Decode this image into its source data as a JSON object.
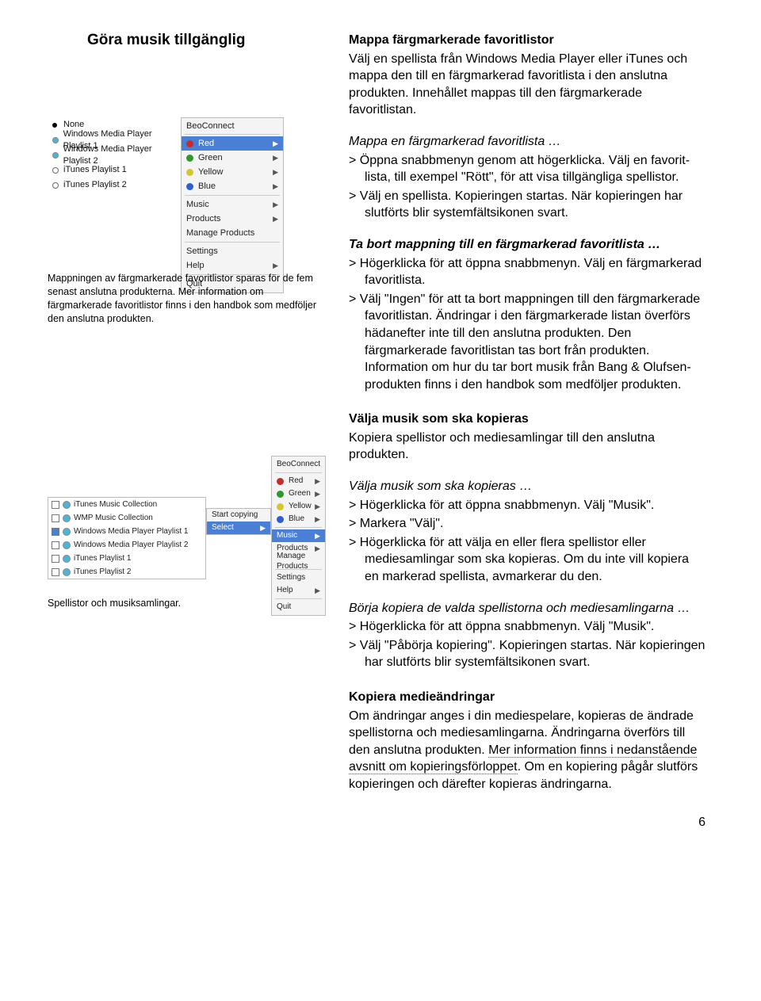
{
  "title": "Göra musik tillgänglig",
  "shot1": {
    "left_items": [
      {
        "mark": "bullet",
        "label": "None"
      },
      {
        "mark": "dot",
        "label": "Windows Media Player Playlist 1"
      },
      {
        "mark": "dot",
        "label": "Windows Media Player Playlist 2"
      },
      {
        "mark": "odot",
        "label": "iTunes Playlist 1"
      },
      {
        "mark": "odot",
        "label": "iTunes Playlist 2"
      }
    ],
    "ctx_header": "BeoConnect",
    "ctx_colors": [
      {
        "cls": "red",
        "label": "Red",
        "sel": true
      },
      {
        "cls": "green",
        "label": "Green"
      },
      {
        "cls": "yellow",
        "label": "Yellow"
      },
      {
        "cls": "blue",
        "label": "Blue"
      }
    ],
    "ctx_group2": [
      "Music",
      "Products",
      "Manage Products"
    ],
    "ctx_group3": [
      "Settings",
      "Help"
    ],
    "ctx_group4": [
      "Quit"
    ]
  },
  "caption1": "Mappningen av färgmarkerade favoritlistor sparas för de fem senast anslutna produkterna. Mer information om färgmarkerade favoritlistor finns i den handbok som medföljer den anslutna produkten.",
  "shot2": {
    "items": [
      {
        "chk": false,
        "label": "iTunes Music Collection"
      },
      {
        "chk": false,
        "label": "WMP Music Collection"
      },
      {
        "chk": true,
        "label": "Windows Media Player Playlist 1"
      },
      {
        "chk": false,
        "label": "Windows Media Player Playlist 2"
      },
      {
        "chk": false,
        "label": "iTunes Playlist 1"
      },
      {
        "chk": false,
        "label": "iTunes Playlist 2"
      }
    ],
    "sub_start": "Start copying",
    "sub_select": "Select",
    "ctx_header": "BeoConnect",
    "ctx_colors": [
      {
        "cls": "red",
        "label": "Red"
      },
      {
        "cls": "green",
        "label": "Green"
      },
      {
        "cls": "yellow",
        "label": "Yellow"
      },
      {
        "cls": "blue",
        "label": "Blue"
      }
    ],
    "music": "Music",
    "group2": [
      "Products",
      "Manage Products"
    ],
    "group3": [
      "Settings",
      "Help"
    ],
    "group4": [
      "Quit"
    ]
  },
  "caption2": "Spellistor och musiksamlingar.",
  "r": {
    "s1_h": "Mappa färgmarkerade favoritlistor",
    "s1_p": "Välj en spellista från Windows Media Player eller iTunes och mappa den till en färgmarkerad favoritlista i den anslutna produkten. Innehållet mappas till den färgmarkerade favoritlistan.",
    "s2_h": "Mappa en färgmarkerad favoritlista …",
    "s2_1a": ">  Öppna snabbmenyn genom att högerklicka. Välj en favorit-",
    "s2_1b": "lista, till exempel \"Rött\", för att visa tillgängliga spellistor.",
    "s2_2": ">  Välj en spellista. Kopieringen startas. När kopieringen har slutförts blir systemfältsikonen svart.",
    "s3_h": "Ta bort mappning till en färgmarkerad favoritlista …",
    "s3_1": ">  Högerklicka för att öppna snabbmenyn. Välj en färgmarkerad favoritlista.",
    "s3_2": ">  Välj \"Ingen\" för att ta bort mappningen till den färgmarkerade favoritlistan. Ändringar i den färgmarkerade listan överförs hädanefter inte till den anslutna produkten. Den färgmarkerade favoritlistan tas bort från produkten. Information om hur du tar bort musik från Bang & Olufsen-produkten finns i den handbok som medföljer produkten.",
    "s4_h": "Välja musik som ska kopieras",
    "s4_p": "Kopiera spellistor och mediesamlingar till den anslutna produkten.",
    "s5_h": "Välja musik som ska kopieras …",
    "s5_1": ">  Högerklicka för att öppna snabbmenyn. Välj \"Musik\".",
    "s5_2": ">  Markera \"Välj\".",
    "s5_3": ">  Högerklicka för att välja en eller flera spellistor eller mediesamlingar som ska kopieras. Om du inte vill kopiera en markerad spellista, avmarkerar du den.",
    "s6_h": "Börja kopiera de valda spellistorna och mediesamlingarna …",
    "s6_1": ">  Högerklicka för att öppna snabbmenyn. Välj \"Musik\".",
    "s6_2": ">  Välj \"Påbörja kopiering\". Kopieringen startas. När kopieringen har slutförts blir systemfältsikonen svart.",
    "s7_h": "Kopiera medieändringar",
    "s7_p1": "Om ändringar anges i din mediespelare, kopieras de ändrade spellistorna och mediesamlingarna. Ändringarna överförs till den anslutna produkten. ",
    "s7_link": "Mer information finns i nedanstående avsnitt om kopieringsförloppet",
    "s7_p2": ". Om en kopiering pågår slutförs kopieringen och därefter kopieras ändringarna."
  },
  "page_no": "6"
}
